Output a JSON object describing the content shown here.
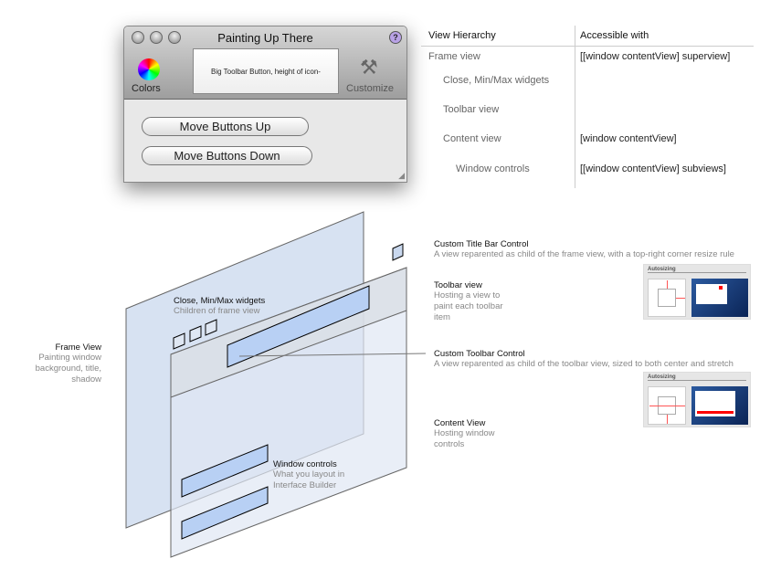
{
  "window": {
    "title": "Painting Up There",
    "help_label": "?",
    "toolbar": {
      "colors_label": "Colors",
      "big_button_label": "Big Toolbar Button, height of icon-",
      "customize_label": "Customize"
    },
    "buttons": {
      "up": "Move Buttons Up",
      "down": "Move Buttons Down"
    }
  },
  "table": {
    "headers": [
      "View Hierarchy",
      "Accessible with"
    ],
    "rows": [
      {
        "view": "Frame view",
        "access": "[[window contentView] superview]"
      },
      {
        "view": "Close, Min/Max widgets",
        "access": ""
      },
      {
        "view": "Toolbar view",
        "access": ""
      },
      {
        "view": "Content view",
        "access": "[window contentView]"
      },
      {
        "view": "Window controls",
        "access": "[[window contentView] subviews]"
      }
    ]
  },
  "diagram": {
    "frame_view": {
      "title": "Frame View",
      "desc": "Painting window background, title, shadow"
    },
    "widgets": {
      "title": "Close, Min/Max widgets",
      "desc": "Children of frame view"
    },
    "window_controls": {
      "title": "Window controls",
      "desc": "What you layout in Interface Builder"
    },
    "title_bar_control": {
      "title": "Custom Title Bar Control",
      "desc": "A view reparented as child of the frame view, with a top-right corner resize rule"
    },
    "toolbar_view": {
      "title": "Toolbar view",
      "desc": "Hosting a view to paint each toolbar item"
    },
    "toolbar_control": {
      "title": "Custom Toolbar Control",
      "desc": "A view reparented as child of the toolbar view, sized to both center and stretch"
    },
    "content_view": {
      "title": "Content View",
      "desc": "Hosting window controls"
    },
    "autosizing_label": "Autosizing"
  },
  "colors": {
    "plane": "#c9d8ee",
    "control": "#b8d0f4",
    "toolbar_plane": "#d8dde4",
    "accent": "#ff0000"
  }
}
